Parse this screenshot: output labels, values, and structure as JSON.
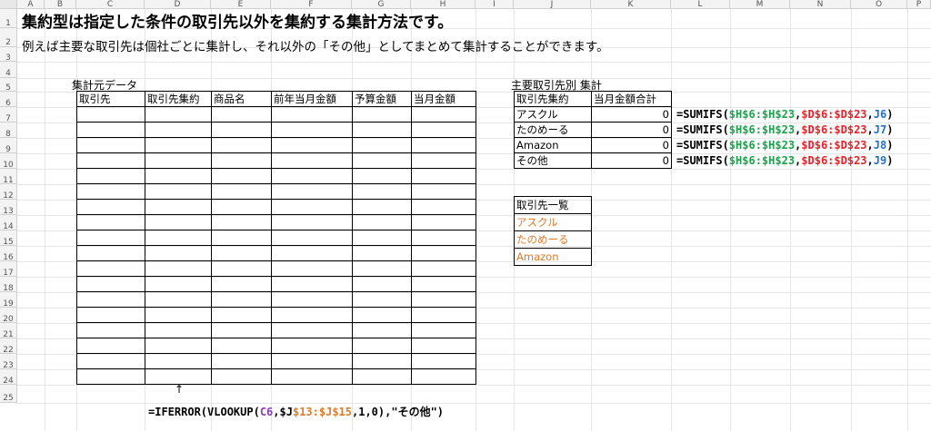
{
  "columns": [
    "A",
    "B",
    "C",
    "D",
    "E",
    "F",
    "G",
    "H",
    "I",
    "J",
    "K",
    "L",
    "M",
    "N",
    "O",
    "P"
  ],
  "rows": [
    "1",
    "2",
    "3",
    "4",
    "5",
    "6",
    "7",
    "8",
    "9",
    "10",
    "11",
    "12",
    "13",
    "14",
    "15",
    "16",
    "17",
    "18",
    "19",
    "20",
    "21",
    "22",
    "23",
    "24",
    "25"
  ],
  "title": "集約型は指定した条件の取引先以外を集約する集計方法です。",
  "subtitle": "例えば主要な取引先は個社ごとに集計し、それ以外の「その他」としてまとめて集計することができます。",
  "source_table": {
    "label": "集計元データ",
    "headers": [
      "取引先",
      "取引先集約",
      "商品名",
      "前年当月金額",
      "予算金額",
      "当月金額"
    ]
  },
  "summary_table": {
    "label": "主要取引先別  集計",
    "headers": [
      "取引先集約",
      "当月金額合計"
    ],
    "rows": [
      {
        "name": "アスクル",
        "value": "0",
        "ref": "J6"
      },
      {
        "name": "たのめーる",
        "value": "0",
        "ref": "J7"
      },
      {
        "name": "Amazon",
        "value": "0",
        "ref": "J8"
      },
      {
        "name": "その他",
        "value": "0",
        "ref": "J9"
      }
    ],
    "formula_parts": [
      "=SUMIFS(",
      "$H$6:$H$23",
      ",",
      "$D$6:$D$23",
      ",",
      ")"
    ]
  },
  "partner_list": {
    "header": "取引先一覧",
    "items": [
      "アスクル",
      "たのめーる",
      "Amazon"
    ]
  },
  "arrow": "↑",
  "bottom_formula": {
    "p1": "=IFERROR(VLOOKUP(",
    "p2": "C6",
    "p3": ",$J",
    "p4": "$13:$J$15",
    "p5": ",1,0),\"その他\")"
  },
  "colors": {
    "green": "#1aa34a",
    "red": "#e8222a",
    "blue": "#1f72c6",
    "purple": "#8a3db5",
    "orange": "#e07b28"
  }
}
